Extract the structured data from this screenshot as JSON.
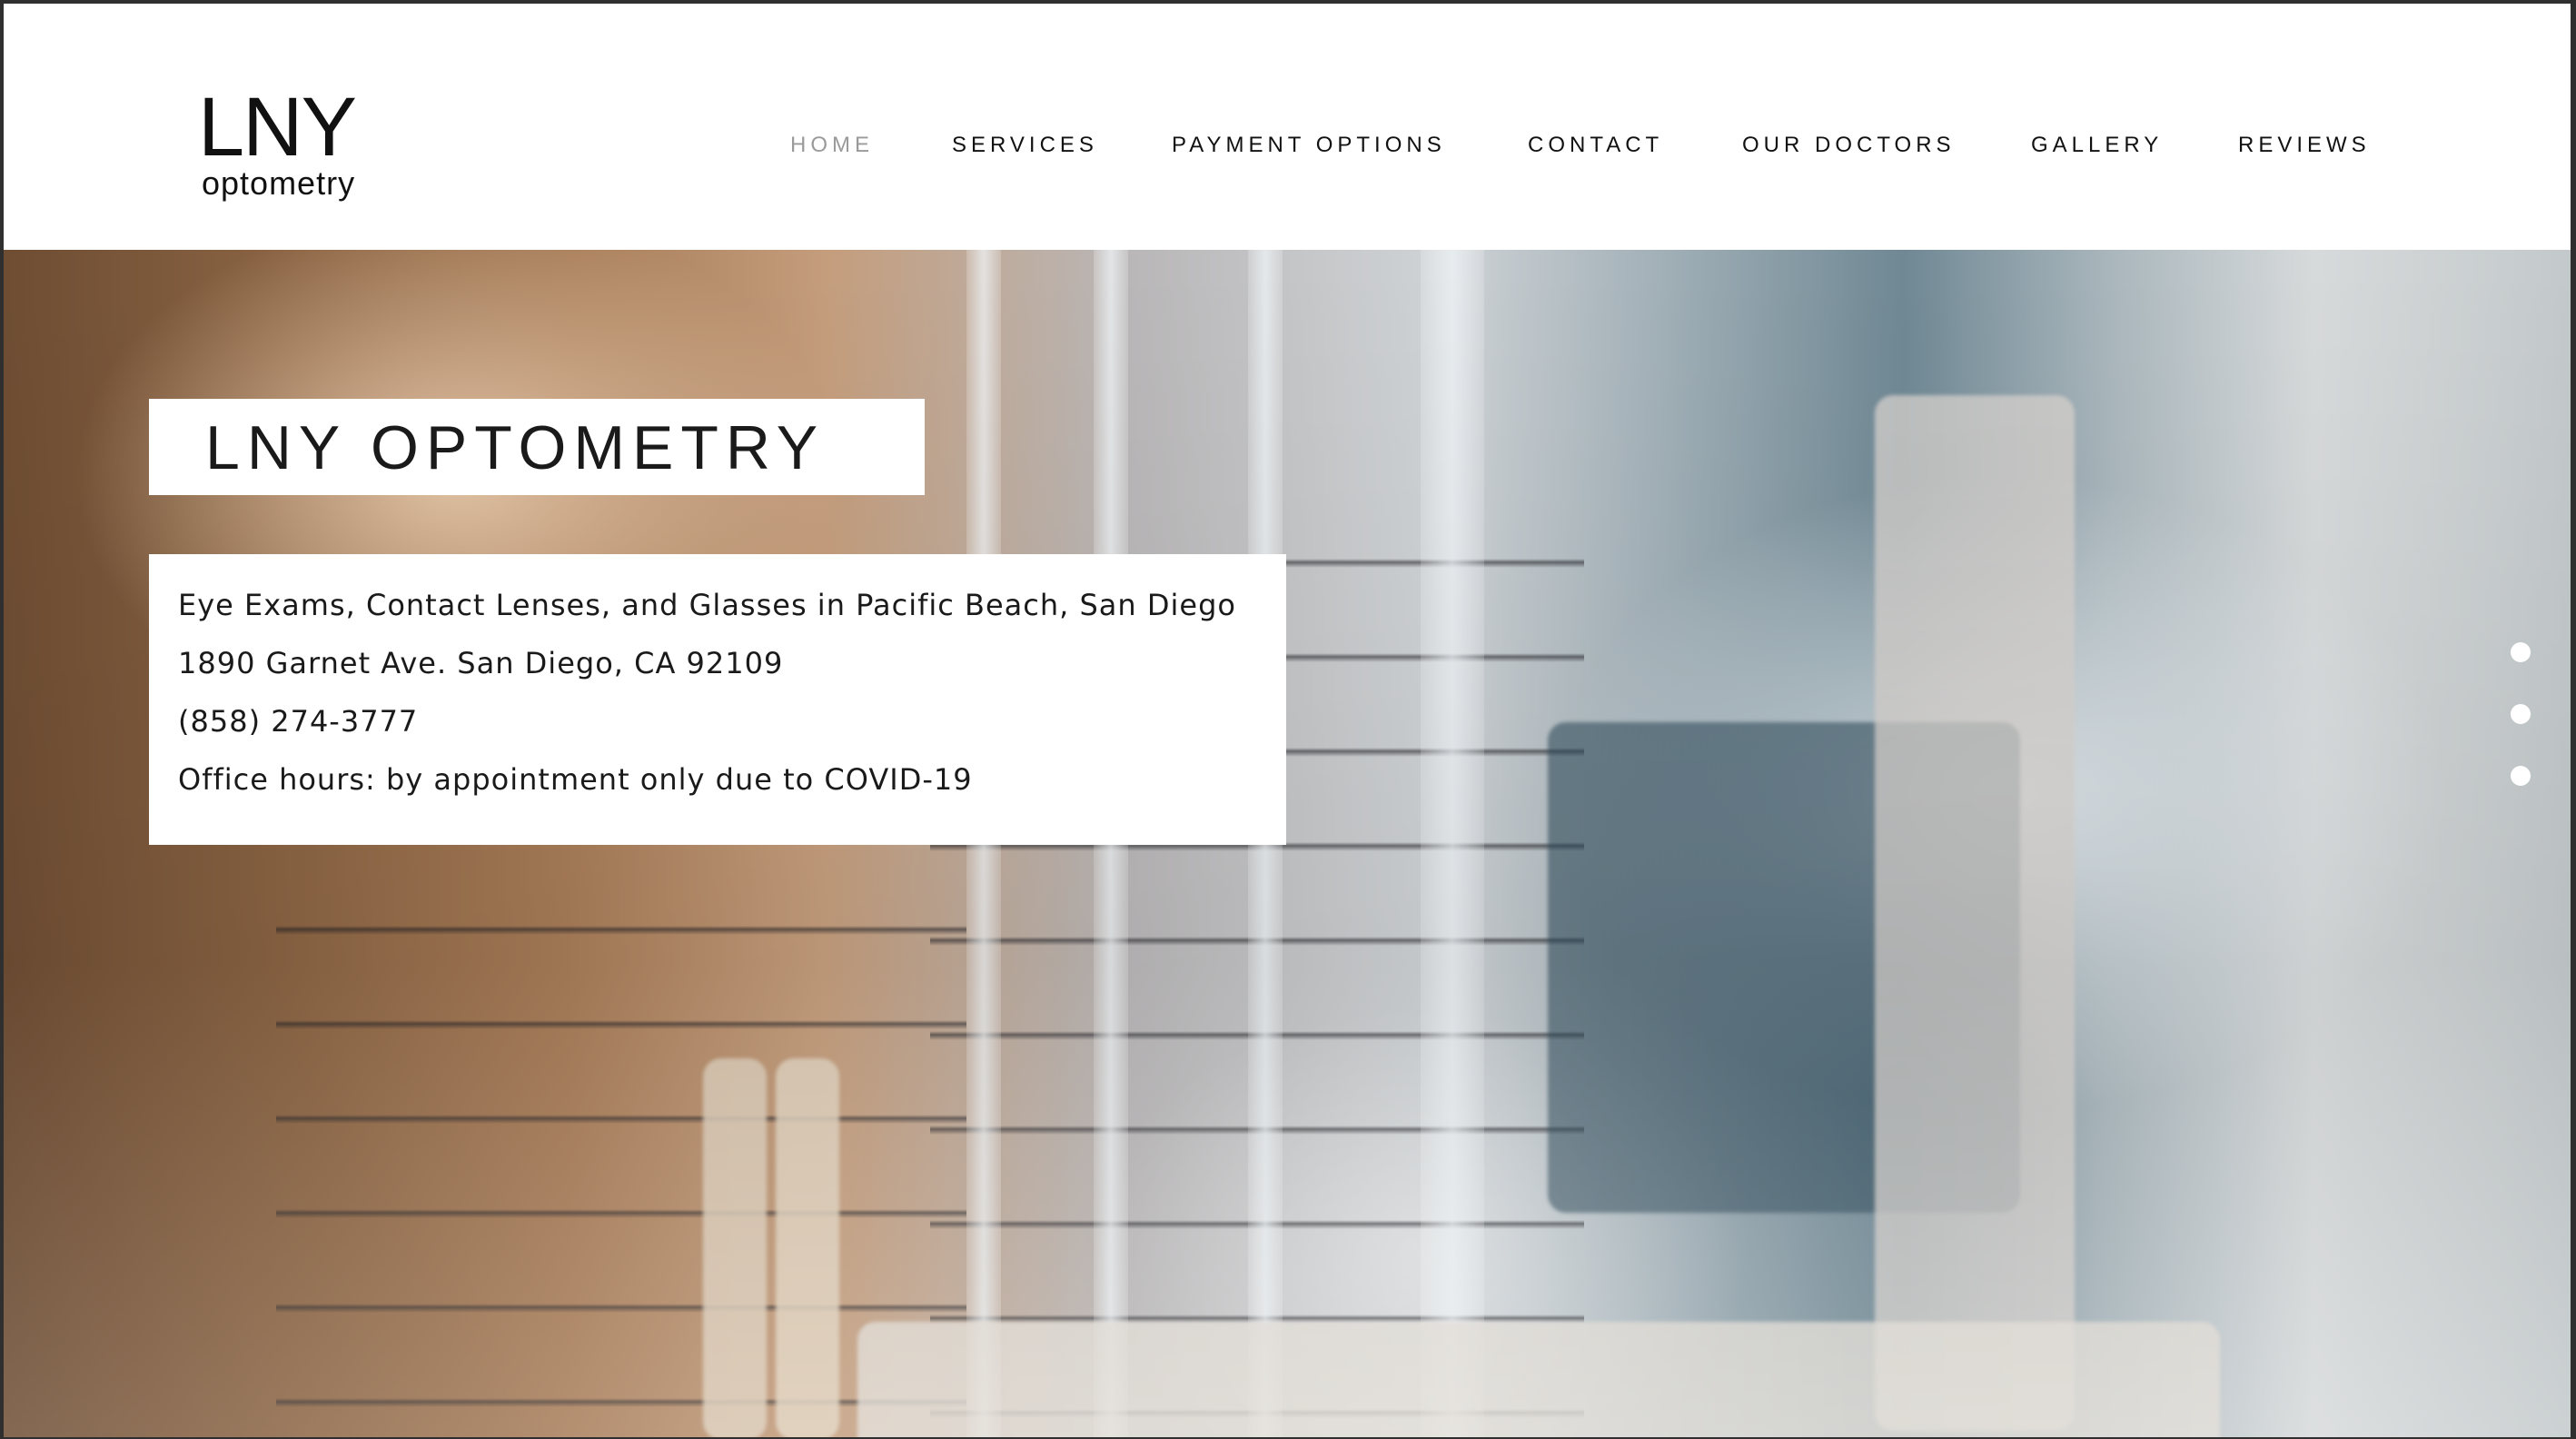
{
  "logo": {
    "main": "LNY",
    "sub": "optometry"
  },
  "nav": {
    "items": [
      {
        "label": "HOME",
        "active": true
      },
      {
        "label": "SERVICES",
        "active": false
      },
      {
        "label": "PAYMENT OPTIONS",
        "active": false
      },
      {
        "label": "CONTACT",
        "active": false
      },
      {
        "label": "OUR DOCTORS",
        "active": false
      },
      {
        "label": "GALLERY",
        "active": false
      },
      {
        "label": "REVIEWS",
        "active": false
      }
    ]
  },
  "hero": {
    "title": "LNY OPTOMETRY",
    "lines": [
      "Eye Exams, Contact Lenses, and Glasses in Pacific Beach, San Diego",
      "1890 Garnet Ave. San Diego, CA 92109",
      "(858) 274-3777",
      "Office hours: by appointment only due to COVID-19"
    ],
    "slide_count": 3
  },
  "colors": {
    "text": "#1a1a1a",
    "nav_active": "#9a9a9a",
    "header_bg": "#ffffff"
  }
}
